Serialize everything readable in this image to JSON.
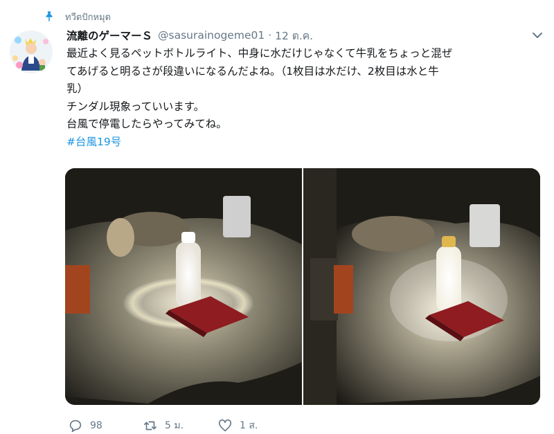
{
  "pinned": {
    "label": "ทวีตปักหมุด"
  },
  "tweet": {
    "display_name": "流離のゲーマーＳ",
    "handle": "@sasurainogeme01",
    "separator": "·",
    "time": "12 ต.ค.",
    "text_lines": [
      "最近よく見るペットボトルライト、中身に水だけじゃなくて牛乳をちょっと混ぜ",
      "てあげると明るさが段違いになるんだよね。（1枚目は水だけ、2枚目は水と牛",
      "乳）",
      "チンダル現象っていいます。",
      "台風で停電したらやってみてね。"
    ],
    "hashtag": "#台風19号"
  },
  "actions": {
    "replies": "98",
    "retweets": "5 ม.",
    "likes": "1 ส."
  },
  "colors": {
    "accent": "#1b95e0",
    "muted": "#657786"
  }
}
